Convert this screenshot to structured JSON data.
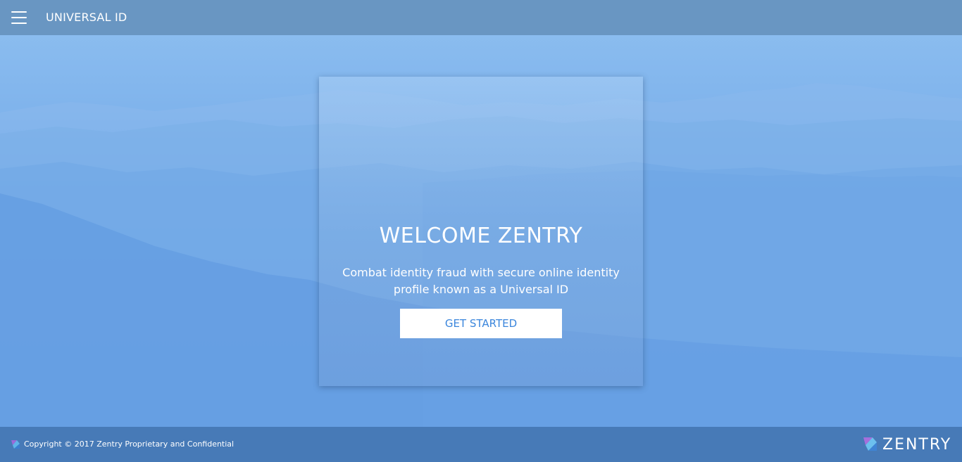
{
  "header": {
    "app_title": "UNIVERSAL ID",
    "menu_icon": "hamburger-menu-icon"
  },
  "hero": {
    "title": "WELCOME ZENTRY",
    "subtitle": "Combat identity fraud with secure online identity profile known as a Universal ID",
    "cta_label": "GET STARTED"
  },
  "footer": {
    "copyright": "Copyright © 2017 Zentry Proprietary and Confidential",
    "brand_name": "ZENTRY",
    "brand_icon": "zentry-logo-icon"
  },
  "colors": {
    "topbar": "#6692be",
    "footer": "#4678b4",
    "background_top": "#8fc0f0",
    "background_bottom": "#579ae6",
    "cta_text": "#3b86dc",
    "text": "#ffffff"
  }
}
